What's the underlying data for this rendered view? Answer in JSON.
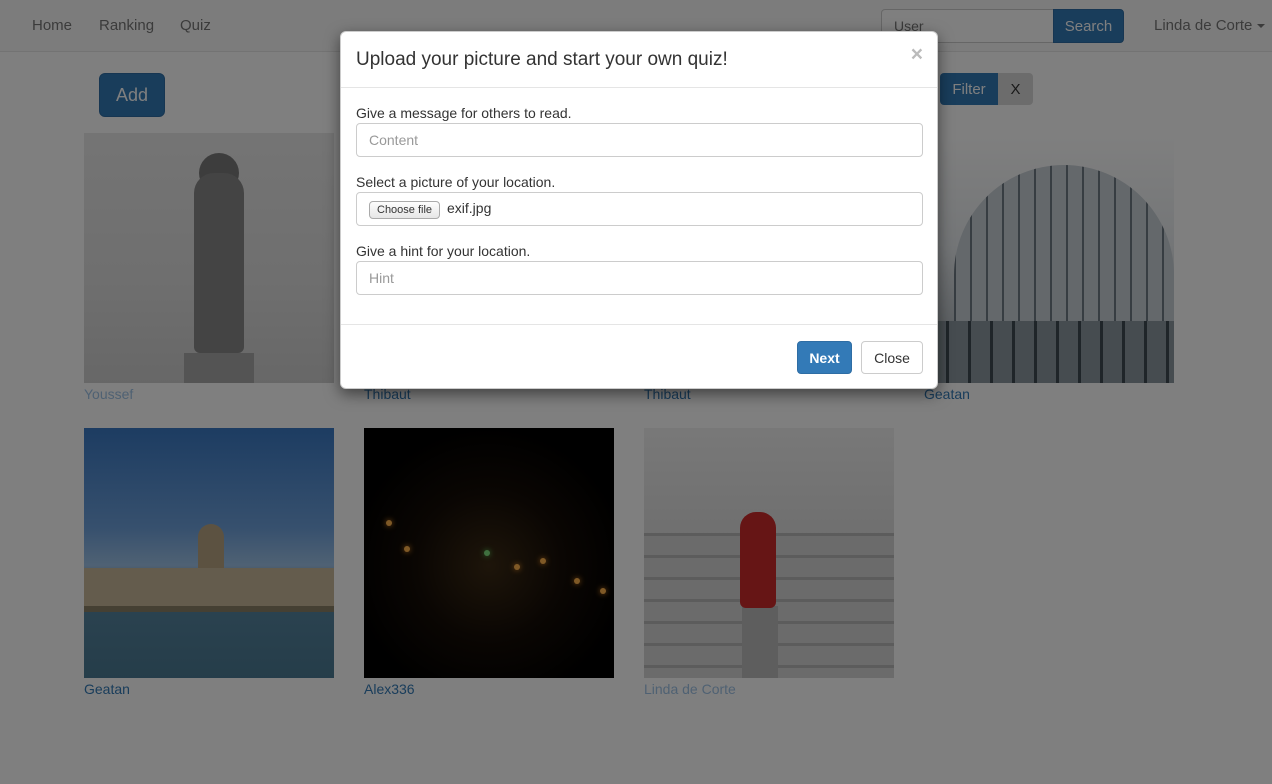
{
  "navbar": {
    "links": [
      "Home",
      "Ranking",
      "Quiz"
    ],
    "search_placeholder": "User",
    "search_button": "Search",
    "user_name": "Linda de Corte"
  },
  "toolbar": {
    "add_label": "Add",
    "filter_label": "Filter",
    "clear_label": "X"
  },
  "gallery": [
    {
      "author": "Youssef",
      "photo": "statue-photo"
    },
    {
      "author": "Thibaut",
      "photo": "hidden-photo"
    },
    {
      "author": "Thibaut",
      "photo": "hidden-photo"
    },
    {
      "author": "Geatan",
      "photo": "dome-photo"
    },
    {
      "author": "Geatan",
      "photo": "parliament-photo"
    },
    {
      "author": "Alex336",
      "photo": "night-street-photo"
    },
    {
      "author": "Linda de Corte",
      "photo": "red-statue-photo"
    }
  ],
  "modal": {
    "title": "Upload your picture and start your own quiz!",
    "close_glyph": "×",
    "message_label": "Give a message for others to read.",
    "message_placeholder": "Content",
    "picture_label": "Select a picture of your location.",
    "file_button": "Choose file",
    "file_name": "exif.jpg",
    "hint_label": "Give a hint for your location.",
    "hint_placeholder": "Hint",
    "next_label": "Next",
    "close_label": "Close"
  },
  "colors": {
    "primary": "#337ab7",
    "backdrop": "rgba(0,0,0,0.5)"
  }
}
